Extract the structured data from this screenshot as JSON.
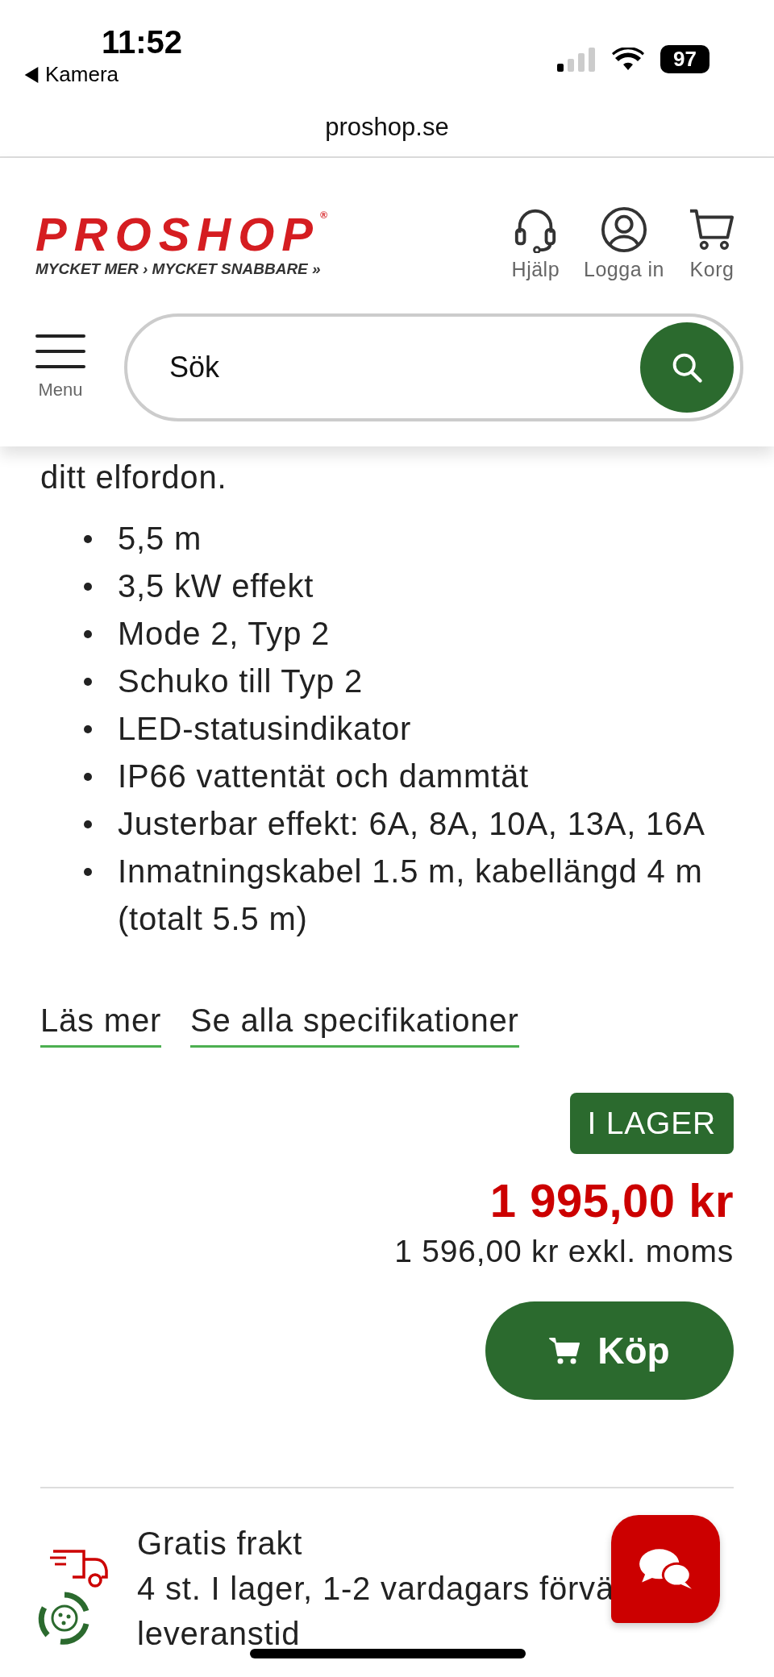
{
  "status_bar": {
    "time": "11:52",
    "back_label": "Kamera",
    "battery": "97"
  },
  "address_bar": {
    "url": "proshop.se"
  },
  "header": {
    "logo": "PROSHOP",
    "logo_mark": "®",
    "tagline": "MYCKET MER › MYCKET SNABBARE »",
    "actions": [
      {
        "kind": "help",
        "label": "Hjälp"
      },
      {
        "kind": "login",
        "label": "Logga in"
      },
      {
        "kind": "cart",
        "label": "Korg"
      }
    ],
    "menu_label": "Menu",
    "search": {
      "placeholder": "Sök"
    }
  },
  "description": {
    "text": "ditt elfordon.",
    "bullets": [
      "5,5 m",
      "3,5 kW effekt",
      "Mode 2, Typ 2",
      "Schuko till Typ 2",
      "LED-statusindikator",
      "IP66 vattentät och dammtät",
      "Justerbar effekt: 6A, 8A, 10A, 13A, 16A",
      "Inmatningskabel 1.5 m, kabellängd 4 m (totalt 5.5 m)"
    ],
    "links": [
      "Läs mer",
      "Se alla specifikationer"
    ]
  },
  "purchase": {
    "stock_badge": "I LAGER",
    "price": "1 995,00 kr",
    "price_excl": "1 596,00 kr exkl. moms",
    "buy_button": "Köp"
  },
  "delivery": {
    "title": "Gratis frakt",
    "line": "4 st. I lager, 1-2 vardagars förvä",
    "line2": "leveranstid"
  }
}
